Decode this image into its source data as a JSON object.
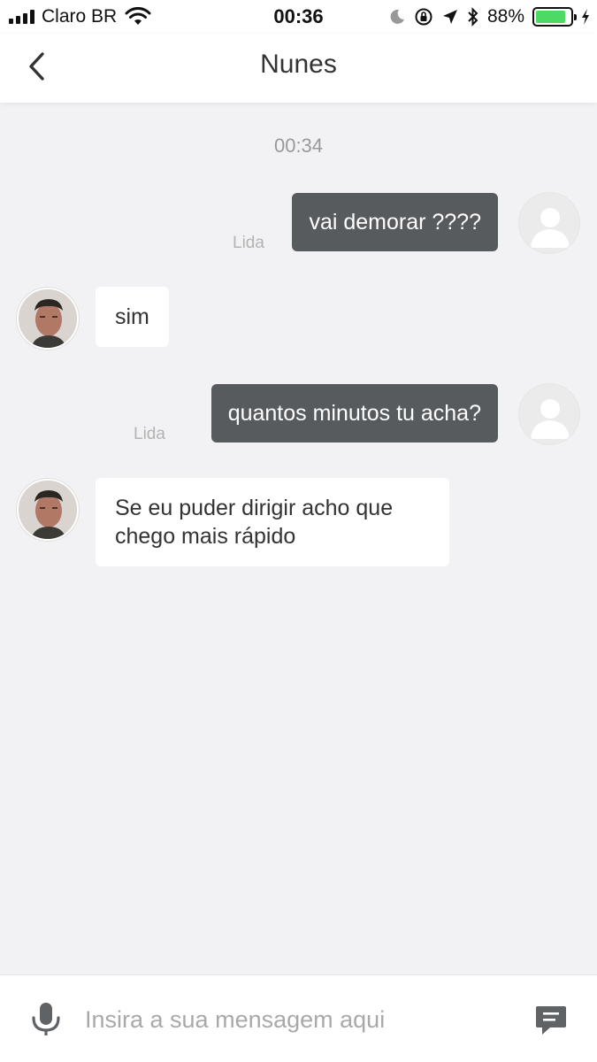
{
  "status_bar": {
    "carrier": "Claro BR",
    "time": "00:36",
    "battery_percent": "88%",
    "battery_level": 0.88,
    "icons": [
      "signal-icon",
      "wifi-icon",
      "moon-icon",
      "orientation-lock-icon",
      "location-icon",
      "bluetooth-icon",
      "battery-icon",
      "charging-icon"
    ]
  },
  "header": {
    "title": "Nunes",
    "back_icon": "chevron-left-icon"
  },
  "chat": {
    "timestamp": "00:34",
    "messages": [
      {
        "direction": "outgoing",
        "text": "vai demorar ????",
        "status": "Lida"
      },
      {
        "direction": "incoming",
        "text": "sim"
      },
      {
        "direction": "outgoing",
        "text": "quantos minutos tu acha?",
        "status": "Lida"
      },
      {
        "direction": "incoming",
        "text": "Se eu puder dirigir acho que chego mais rápido"
      }
    ]
  },
  "composer": {
    "placeholder": "Insira a sua mensagem aqui",
    "value": "",
    "mic_icon": "microphone-icon",
    "send_icon": "message-send-icon"
  },
  "colors": {
    "background": "#f2f2f4",
    "outgoing_bubble": "#575b5e",
    "incoming_bubble": "#ffffff",
    "battery": "#4cd964"
  }
}
